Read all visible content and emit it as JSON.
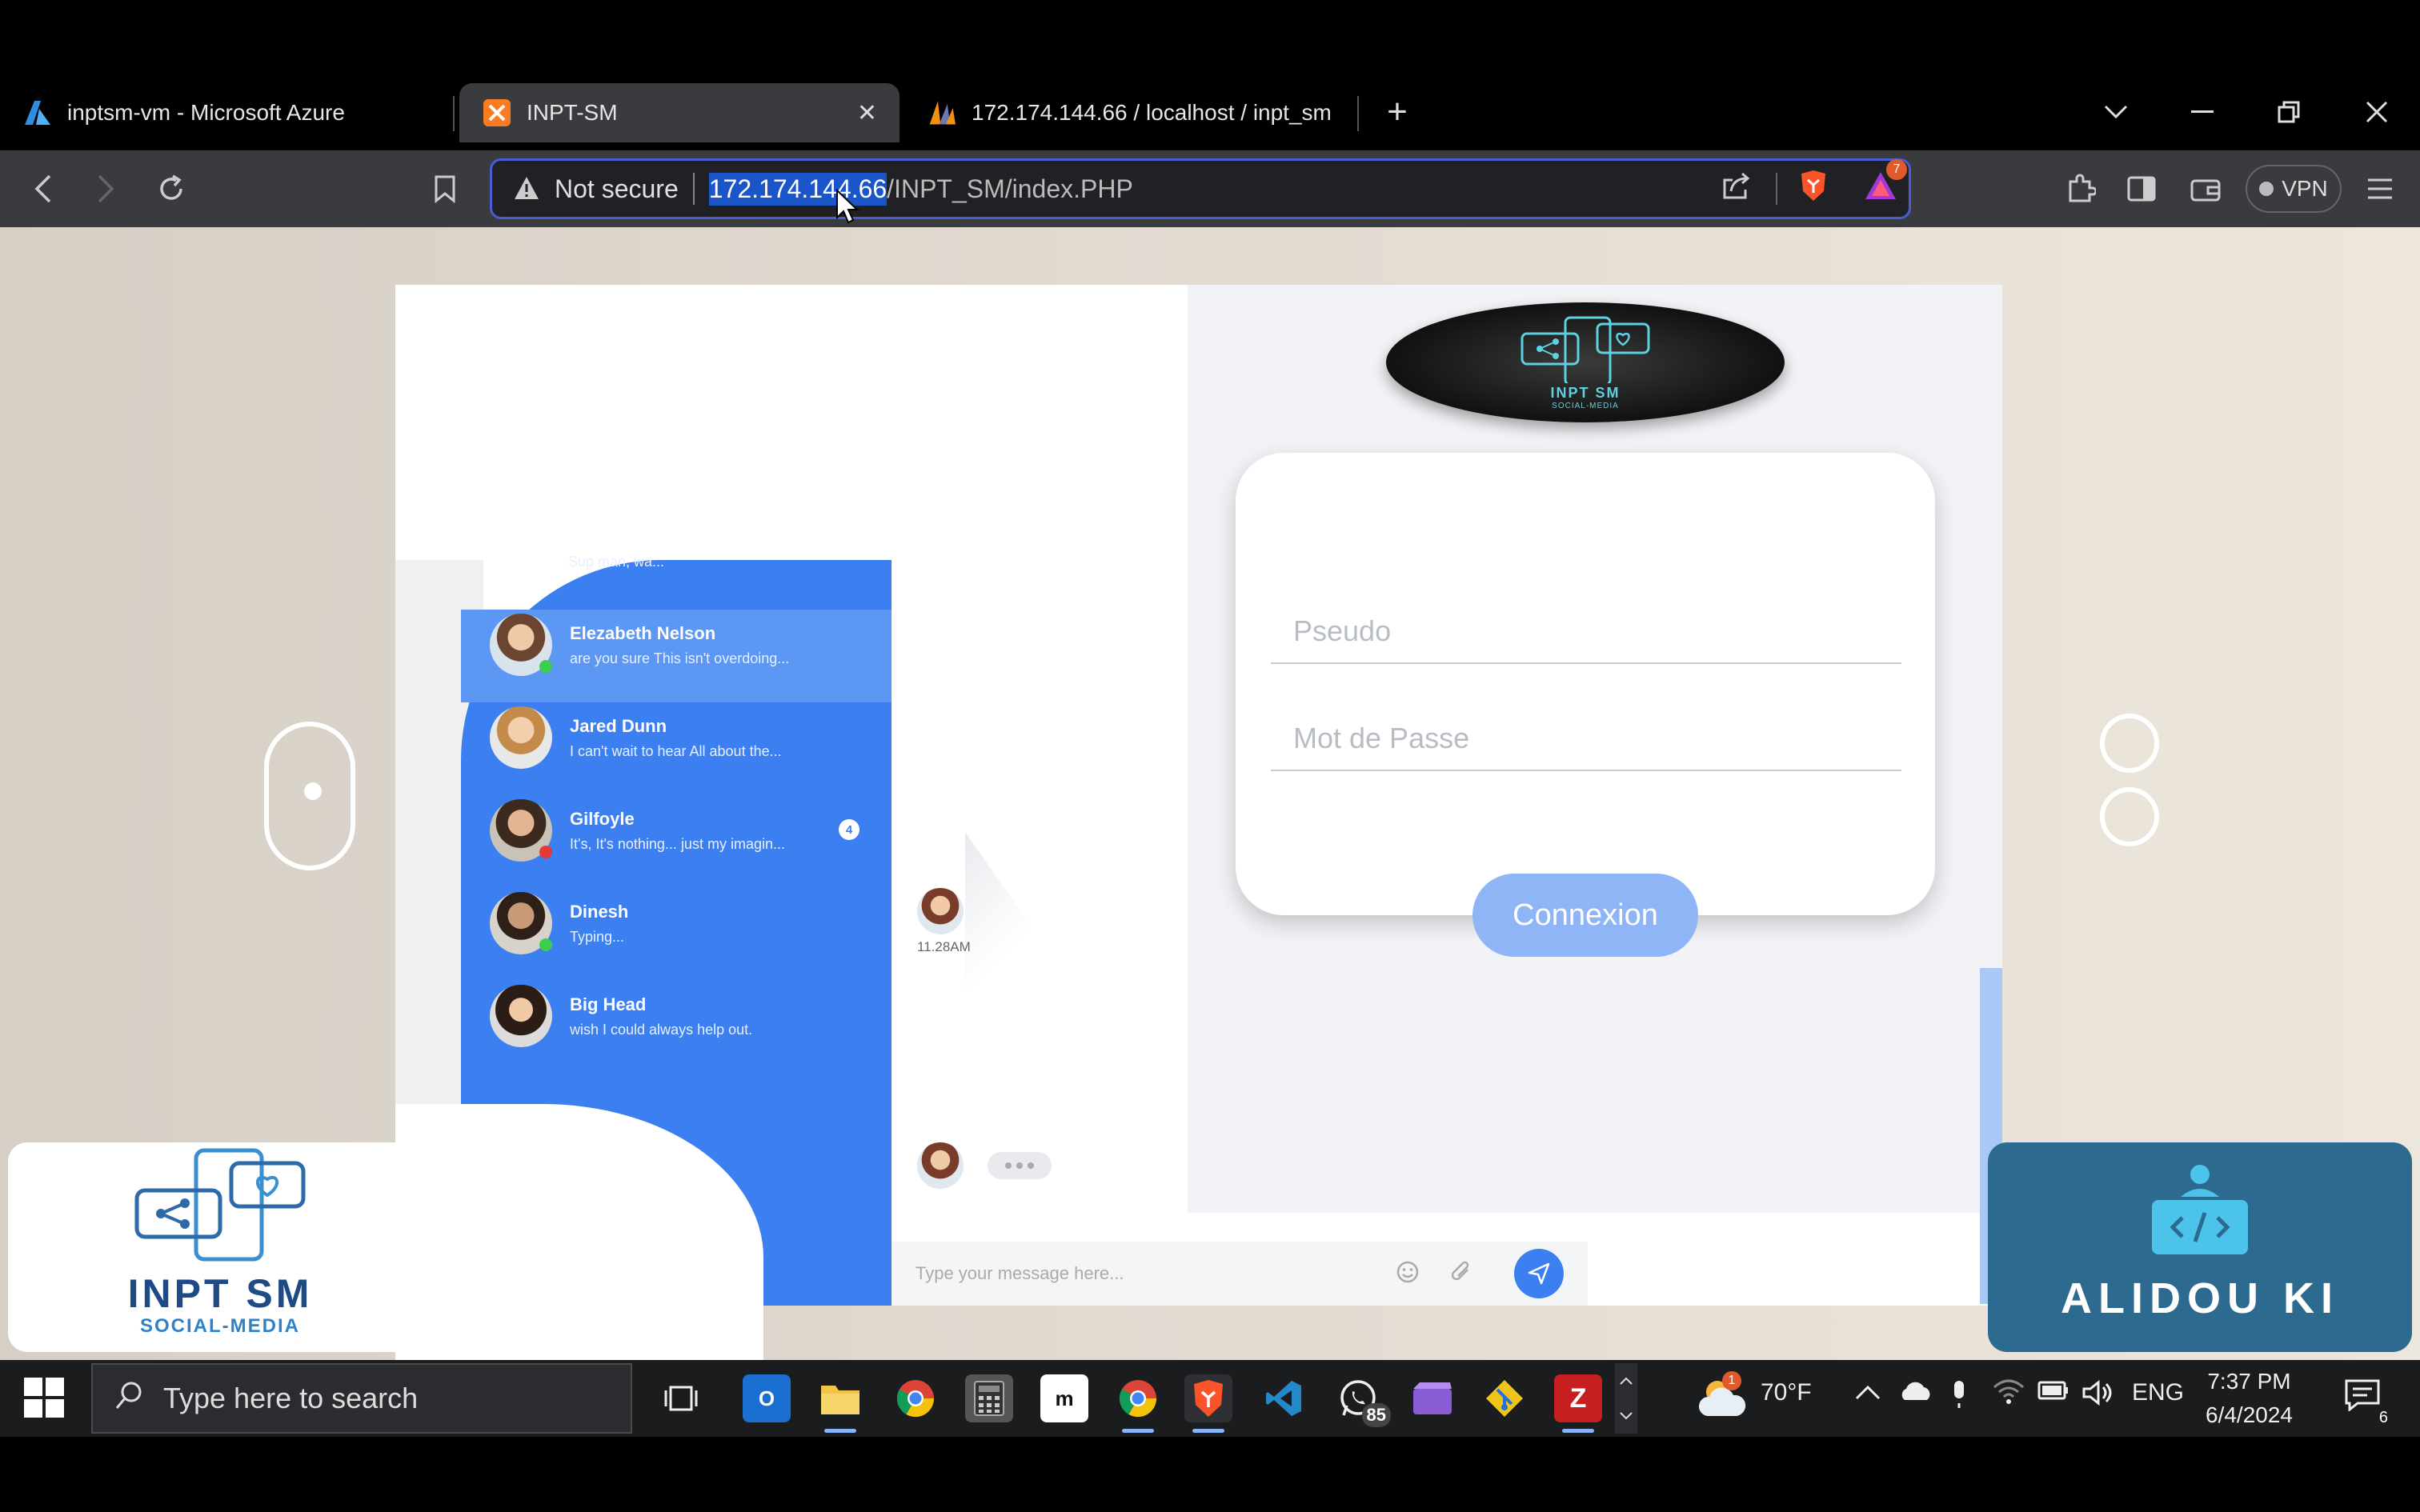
{
  "browser": {
    "tabs": [
      {
        "title": "inptsm-vm - Microsoft Azure",
        "icon": "azure-icon",
        "active": false
      },
      {
        "title": "INPT-SM",
        "icon": "xampp-icon",
        "active": true
      },
      {
        "title": "172.174.144.66 / localhost / inpt_sm",
        "icon": "phpmyadmin-icon",
        "active": false
      }
    ],
    "new_tab": "+",
    "address": {
      "security": "Not secure",
      "host": "172.174.144.66",
      "path": "/INPT_SM/index.PHP"
    },
    "brave_rewards_count": "7",
    "vpn_label": "VPN"
  },
  "chat_preview": {
    "top_snippet": "Sup man, wa...",
    "conversations": [
      {
        "name": "Elezabeth Nelson",
        "message": "are you sure This isn't overdoing...",
        "status": "online",
        "selected": true
      },
      {
        "name": "Jared Dunn",
        "message": "I can't wait to hear All about the...",
        "status": "none"
      },
      {
        "name": "Gilfoyle",
        "message": "It's, It's nothing... just my imagin...",
        "status": "busy",
        "unread": "4"
      },
      {
        "name": "Dinesh",
        "message": "Typing...",
        "status": "online"
      },
      {
        "name": "Big Head",
        "message": "wish I could always help out.",
        "status": "none"
      }
    ],
    "message_time": "11.28AM",
    "input_placeholder": "Type your message here..."
  },
  "login": {
    "logo_title": "INPT SM",
    "logo_subtitle": "SOCIAL-MEDIA",
    "pseudo_placeholder": "Pseudo",
    "password_placeholder": "Mot de Passe",
    "submit_label": "Connexion"
  },
  "overlays": {
    "left_title": "INPT SM",
    "left_subtitle": "SOCIAL-MEDIA",
    "right_title": "ALIDOU KI"
  },
  "taskbar": {
    "search_placeholder": "Type here to search",
    "whatsapp_badge": "85",
    "weather_badge": "1",
    "temperature": "70°F",
    "language": "ENG",
    "time": "7:37 PM",
    "date": "6/4/2024",
    "notifications": "6"
  },
  "colors": {
    "accent_blue": "#3b7ff0",
    "button_blue": "#8fb5f6",
    "omnibox_border": "#4a5cd6"
  }
}
